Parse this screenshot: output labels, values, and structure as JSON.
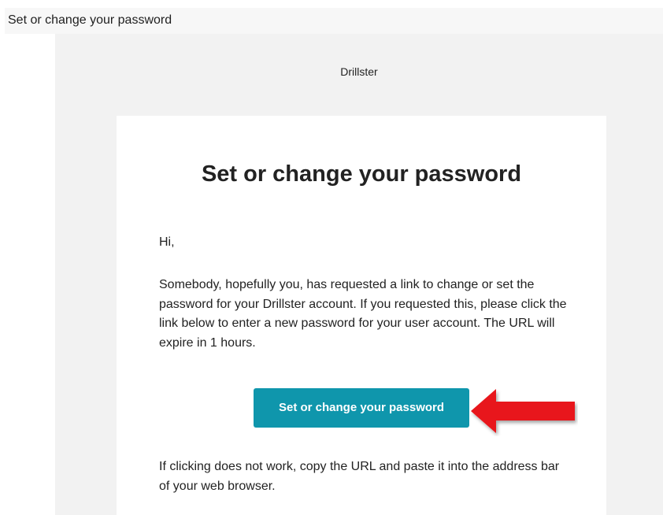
{
  "subject": "Set or change your password",
  "email": {
    "brand": "Drillster",
    "title": "Set or change your password",
    "greeting": "Hi,",
    "body": "Somebody, hopefully you, has requested a link to change or set the password for your Drillster account. If you requested this, please click the link below to enter a new password for your user account. The URL will expire in 1 hours.",
    "button_label": "Set or change your password",
    "fallback": "If clicking does not work, copy the URL and paste it into the address bar of your web browser."
  },
  "colors": {
    "button": "#0f96ac",
    "annotation_arrow": "#e8191a"
  },
  "annotation": {
    "icon": "red-arrow-icon"
  }
}
